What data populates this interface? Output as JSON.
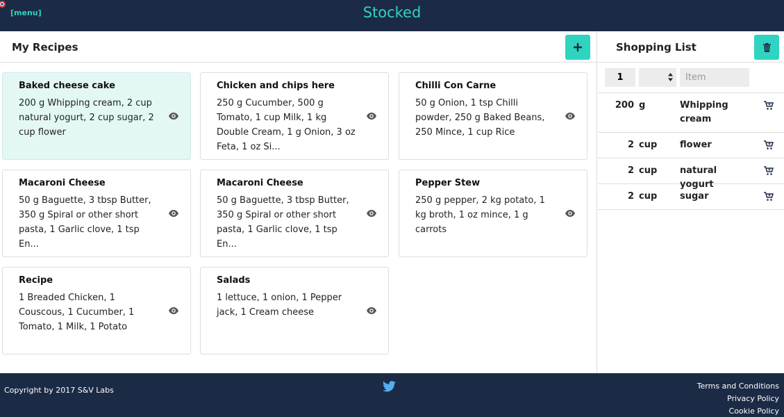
{
  "header": {
    "menu_label": "[menu]",
    "brand": "Stocked"
  },
  "recipes": {
    "title": "My Recipes",
    "items": [
      {
        "name": "Baked cheese cake",
        "ingredients": "200 g Whipping cream, 2 cup natural yogurt, 2 cup sugar, 2 cup flower"
      },
      {
        "name": "Chicken and chips here",
        "ingredients": "250 g Cucumber, 500 g Tomato, 1 cup Milk, 1 kg Double Cream, 1 g Onion, 3 oz Feta, 1 oz Si..."
      },
      {
        "name": "Chilli Con Carne",
        "ingredients": "50 g Onion, 1 tsp Chilli powder, 250 g Baked Beans, 250 Mince, 1 cup Rice"
      },
      {
        "name": "Macaroni Cheese",
        "ingredients": "50 g Baguette, 3 tbsp Butter, 350 g Spiral or other short pasta, 1 Garlic clove, 1 tsp En..."
      },
      {
        "name": "Macaroni Cheese",
        "ingredients": "50 g Baguette, 3 tbsp Butter, 350 g Spiral or other short pasta, 1 Garlic clove, 1 tsp En..."
      },
      {
        "name": "Pepper Stew",
        "ingredients": "250 g pepper, 2 kg potato, 1 kg broth, 1 oz mince, 1 g carrots"
      },
      {
        "name": "Recipe",
        "ingredients": "1 Breaded Chicken, 1 Couscous, 1 Cucumber, 1 Tomato, 1 Milk, 1 Potato"
      },
      {
        "name": "Salads",
        "ingredients": "1 lettuce, 1 onion, 1 Pepper jack, 1 Cream cheese"
      }
    ]
  },
  "shopping": {
    "title": "Shopping List",
    "new_item": {
      "quantity": "1",
      "unit": "",
      "item_placeholder": "Item"
    },
    "items": [
      {
        "qty": "200",
        "unit": "g",
        "name": "Whipping cream"
      },
      {
        "qty": "2",
        "unit": "cup",
        "name": "flower"
      },
      {
        "qty": "2",
        "unit": "cup",
        "name": "natural yogurt"
      },
      {
        "qty": "2",
        "unit": "cup",
        "name": "sugar"
      }
    ]
  },
  "footer": {
    "copyright": "Copyright by 2017 S&V Labs",
    "links": [
      "Terms and Conditions",
      "Privacy Policy",
      "Cookie Policy"
    ]
  },
  "colors": {
    "navbar": "#1b2a45",
    "accent": "#2ed4c0",
    "active_card": "#e3f8f5",
    "twitter": "#55acee"
  }
}
